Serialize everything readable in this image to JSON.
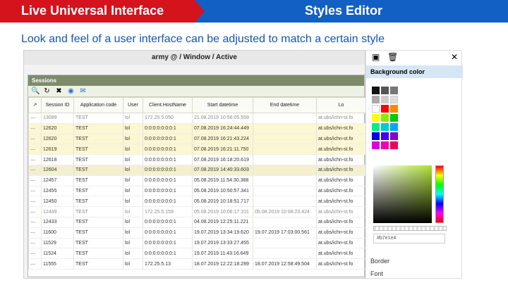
{
  "banner": {
    "left_title": "Live Universal Interface",
    "right_title": "Styles Editor"
  },
  "subtitle": "Look and feel of a user interface can be adjusted to match a certain style",
  "app": {
    "title": "army @ / Window / Active",
    "sessions_title": "Sessions",
    "columns": [
      "↗",
      "Session ID",
      "Application code",
      "User",
      "Client.HostName",
      "Start datetime",
      "End datetime",
      "Lo"
    ],
    "rows": [
      {
        "id": "13099",
        "app": "TEST",
        "user": "lol",
        "host": "172.25.5.050",
        "start": "21.08.2019 10:56:05.559",
        "end": "",
        "loc": "at.ubs/ichn-st.fo",
        "cls": "gray"
      },
      {
        "id": "12620",
        "app": "TEST",
        "user": "lol",
        "host": "0:0:0:0:0:0:0:1",
        "start": "07.08.2019 16:24:44.449",
        "end": "",
        "loc": "at.ubs/ichn-st.fo",
        "cls": "hl"
      },
      {
        "id": "12620",
        "app": "TEST",
        "user": "lol",
        "host": "0:0:0:0:0:0:0:1",
        "start": "07.08.2019 16:21:43.224",
        "end": "",
        "loc": "at.ubs/ichn-st.fo",
        "cls": "hl"
      },
      {
        "id": "12619",
        "app": "TEST",
        "user": "lol",
        "host": "0:0:0:0:0:0:0:1",
        "start": "07.08.2019 16:21:11.750",
        "end": "",
        "loc": "at.ubs/ichn-st.fo",
        "cls": "hl"
      },
      {
        "id": "12618",
        "app": "TEST",
        "user": "lol",
        "host": "0:0:0:0:0:0:0:1",
        "start": "07.08.2019 16:18:20.619",
        "end": "",
        "loc": "at.ubs/ichn-st.fo",
        "cls": ""
      },
      {
        "id": "12604",
        "app": "TEST",
        "user": "lol",
        "host": "0:0:0:0:0:0:0:1",
        "start": "07.08.2019 14:40:33.603",
        "end": "",
        "loc": "at.ubs/ichn-st.fo",
        "cls": "sel"
      },
      {
        "id": "12457",
        "app": "TEST",
        "user": "lol",
        "host": "0:0:0:0:0:0:0:1",
        "start": "05.08.2019 11:54:30.388",
        "end": "",
        "loc": "at.ubs/ichn-st.fo",
        "cls": ""
      },
      {
        "id": "12455",
        "app": "TEST",
        "user": "lol",
        "host": "0:0:0:0:0:0:0:1",
        "start": "05.08.2019 10:50:57.341",
        "end": "",
        "loc": "at.ubs/ichn-st.fo",
        "cls": ""
      },
      {
        "id": "12450",
        "app": "TEST",
        "user": "lol",
        "host": "0:0:0:0:0:0:0:1",
        "start": "05.08.2019 10:18:51.717",
        "end": "",
        "loc": "at.ubs/ichn-st.fo",
        "cls": ""
      },
      {
        "id": "12449",
        "app": "TEST",
        "user": "lol",
        "host": "172.25.5.159",
        "start": "05.08.2019 10:06:17.101",
        "end": "05.08.2019 10:08:23.424",
        "loc": "at.ubs/ichn-st.fo",
        "cls": "gray"
      },
      {
        "id": "12433",
        "app": "TEST",
        "user": "lol",
        "host": "0:0:0:0:0:0:0:1",
        "start": "04.08.2019 12:25:11.221",
        "end": "",
        "loc": "at.ubs/ichn-st.fo",
        "cls": ""
      },
      {
        "id": "11600",
        "app": "TEST",
        "user": "lol",
        "host": "0:0:0:0:0:0:0:1",
        "start": "19.07.2019 13:34:19.620",
        "end": "19.07.2019 17:03:00.561",
        "loc": "at.ubs/ichn-st.fo",
        "cls": ""
      },
      {
        "id": "11529",
        "app": "TEST",
        "user": "lol",
        "host": "0:0:0:0:0:0:0:1",
        "start": "19.07.2019 13:33:27.455",
        "end": "",
        "loc": "at.ubs/ichn-st.fo",
        "cls": ""
      },
      {
        "id": "11524",
        "app": "TEST",
        "user": "lol",
        "host": "0:0:0:0:0:0:0:1",
        "start": "19.07.2019 11:43:16.649",
        "end": "",
        "loc": "at.ubs/ichn-st.fo",
        "cls": ""
      },
      {
        "id": "11555",
        "app": "TEST",
        "user": "lol",
        "host": "172.25.5.13",
        "start": "18.07.2019 12:22:18.289",
        "end": "18.07.2019 12:58:49.504",
        "loc": "at.ubs/ichn-st.fo",
        "cls": ""
      }
    ]
  },
  "panel": {
    "section_title": "Background color",
    "hex_value": "#b7e1e4",
    "border_label": "Border",
    "font_label": "Font",
    "swatches": [
      "#111111",
      "#555555",
      "#777777",
      "#aaaaaa",
      "#cccccc",
      "#dddddd",
      "#ffffff",
      "#ff0000",
      "#ff8800",
      "#ffff00",
      "#88ee00",
      "#00cc00",
      "#00ee88",
      "#00cccc",
      "#00aaee",
      "#0000ee",
      "#4400ee",
      "#8800cc",
      "#dd00dd",
      "#ee00aa",
      "#ee0055"
    ]
  }
}
